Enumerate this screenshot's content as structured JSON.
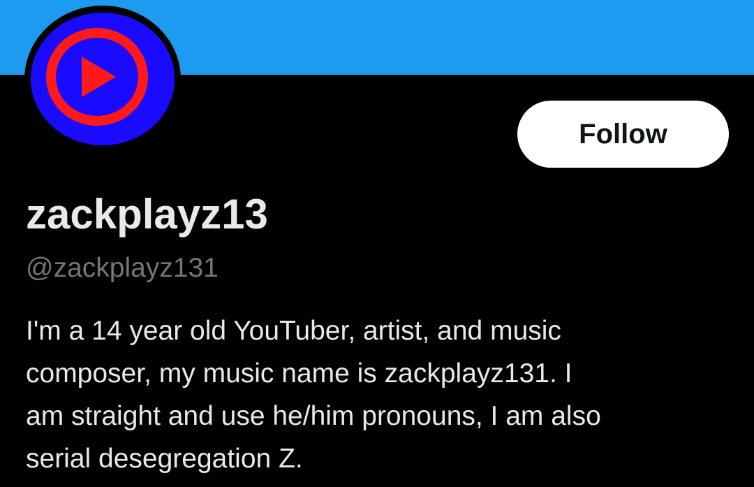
{
  "colors": {
    "banner": "#1d9bf0",
    "background": "#000000",
    "avatar_ring_outer": "#1a0aff",
    "avatar_ring_red": "#ff1a1a",
    "avatar_play": "#ff1a1a",
    "primary_text": "#e7e9ea",
    "secondary_text": "#71767b",
    "follow_bg": "#ffffff",
    "follow_text": "#0f1419"
  },
  "profile": {
    "avatar_icon": "play-button-logo",
    "display_name": "zackplayz13",
    "handle": "@zackplayz131",
    "bio": "I'm a 14 year old YouTuber, artist, and music\ncomposer,  my music name is zackplayz131. I\nam straight and use he/him pronouns, I am also\nserial desegregation Z."
  },
  "actions": {
    "follow_label": "Follow"
  }
}
